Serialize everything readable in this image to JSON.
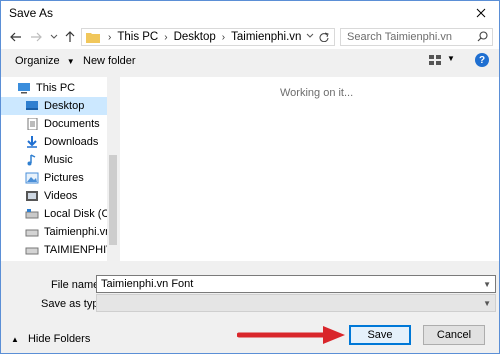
{
  "window": {
    "title": "Save As"
  },
  "nav": {
    "address": {
      "crumbs": [
        "This PC",
        "Desktop",
        "Taimienphi.vn"
      ]
    },
    "search_placeholder": "Search Taimienphi.vn"
  },
  "toolbar": {
    "organize_label": "Organize",
    "new_folder_label": "New folder"
  },
  "sidebar": {
    "items": [
      {
        "label": "This PC",
        "icon": "computer-icon"
      },
      {
        "label": "Desktop",
        "icon": "desktop-icon",
        "selected": true
      },
      {
        "label": "Documents",
        "icon": "documents-icon"
      },
      {
        "label": "Downloads",
        "icon": "downloads-icon"
      },
      {
        "label": "Music",
        "icon": "music-icon"
      },
      {
        "label": "Pictures",
        "icon": "pictures-icon"
      },
      {
        "label": "Videos",
        "icon": "videos-icon"
      },
      {
        "label": "Local Disk (C:)",
        "icon": "disk-icon"
      },
      {
        "label": "Taimienphi.vn (D",
        "icon": "drive-icon"
      },
      {
        "label": "TAIMIENPHIVN (",
        "icon": "drive-icon"
      }
    ]
  },
  "main": {
    "status_text": "Working on it..."
  },
  "form": {
    "file_name_label": "File name:",
    "file_name_value": "Taimienphi.vn Font",
    "save_as_type_label": "Save as type:",
    "save_as_type_value": ""
  },
  "footer": {
    "hide_folders_label": "Hide Folders",
    "save_label": "Save",
    "cancel_label": "Cancel"
  },
  "colors": {
    "accent": "#0078d7",
    "selection": "#cce8ff",
    "annotation_arrow": "#d9262b"
  }
}
